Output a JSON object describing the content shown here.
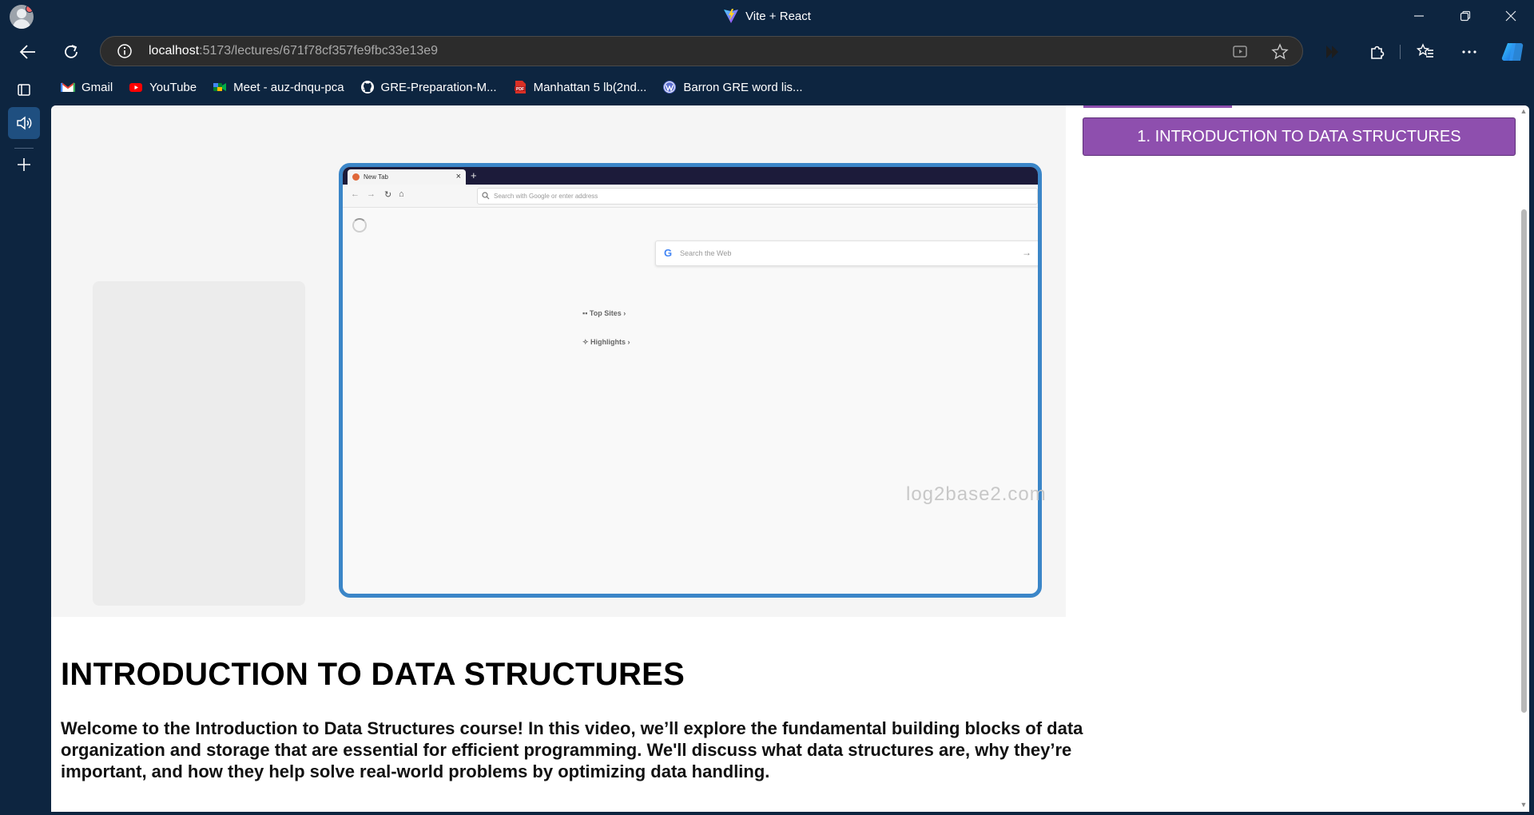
{
  "window": {
    "title": "Vite + React",
    "controls": [
      "minimize-icon",
      "restore-icon",
      "close-icon"
    ]
  },
  "address_bar": {
    "url_host": "localhost",
    "url_rest": ":5173/lectures/671f78cf357fe9fbc33e13e9"
  },
  "bookmarks": [
    {
      "label": "Gmail",
      "icon": "gmail-icon"
    },
    {
      "label": "YouTube",
      "icon": "youtube-icon"
    },
    {
      "label": "Meet - auz-dnqu-pca",
      "icon": "meet-icon"
    },
    {
      "label": "GRE-Preparation-M...",
      "icon": "github-icon"
    },
    {
      "label": "Manhattan 5 lb(2nd...",
      "icon": "pdf-icon"
    },
    {
      "label": "Barron GRE word lis...",
      "icon": "wordpress-icon"
    }
  ],
  "video_content": {
    "tab_label": "New Tab",
    "address_placeholder": "Search with Google or enter address",
    "search_placeholder": "Search the Web",
    "top_sites": "Top Sites",
    "highlights": "Highlights",
    "watermark": "log2base2.com"
  },
  "sidebar": {
    "lecture_button": "1. INTRODUCTION TO DATA STRUCTURES"
  },
  "lecture": {
    "title": "INTRODUCTION TO DATA STRUCTURES",
    "description": "Welcome to the Introduction to Data Structures course! In this video, we’ll explore the fundamental building blocks of data organization and storage that are essential for efficient programming. We'll discuss what data structures are, why they’re important, and how they help solve real-world problems by optimizing data handling."
  },
  "colors": {
    "browser_chrome": "#0d2540",
    "accent_purple": "#8e4fae",
    "frame_blue": "#3b86c8"
  }
}
